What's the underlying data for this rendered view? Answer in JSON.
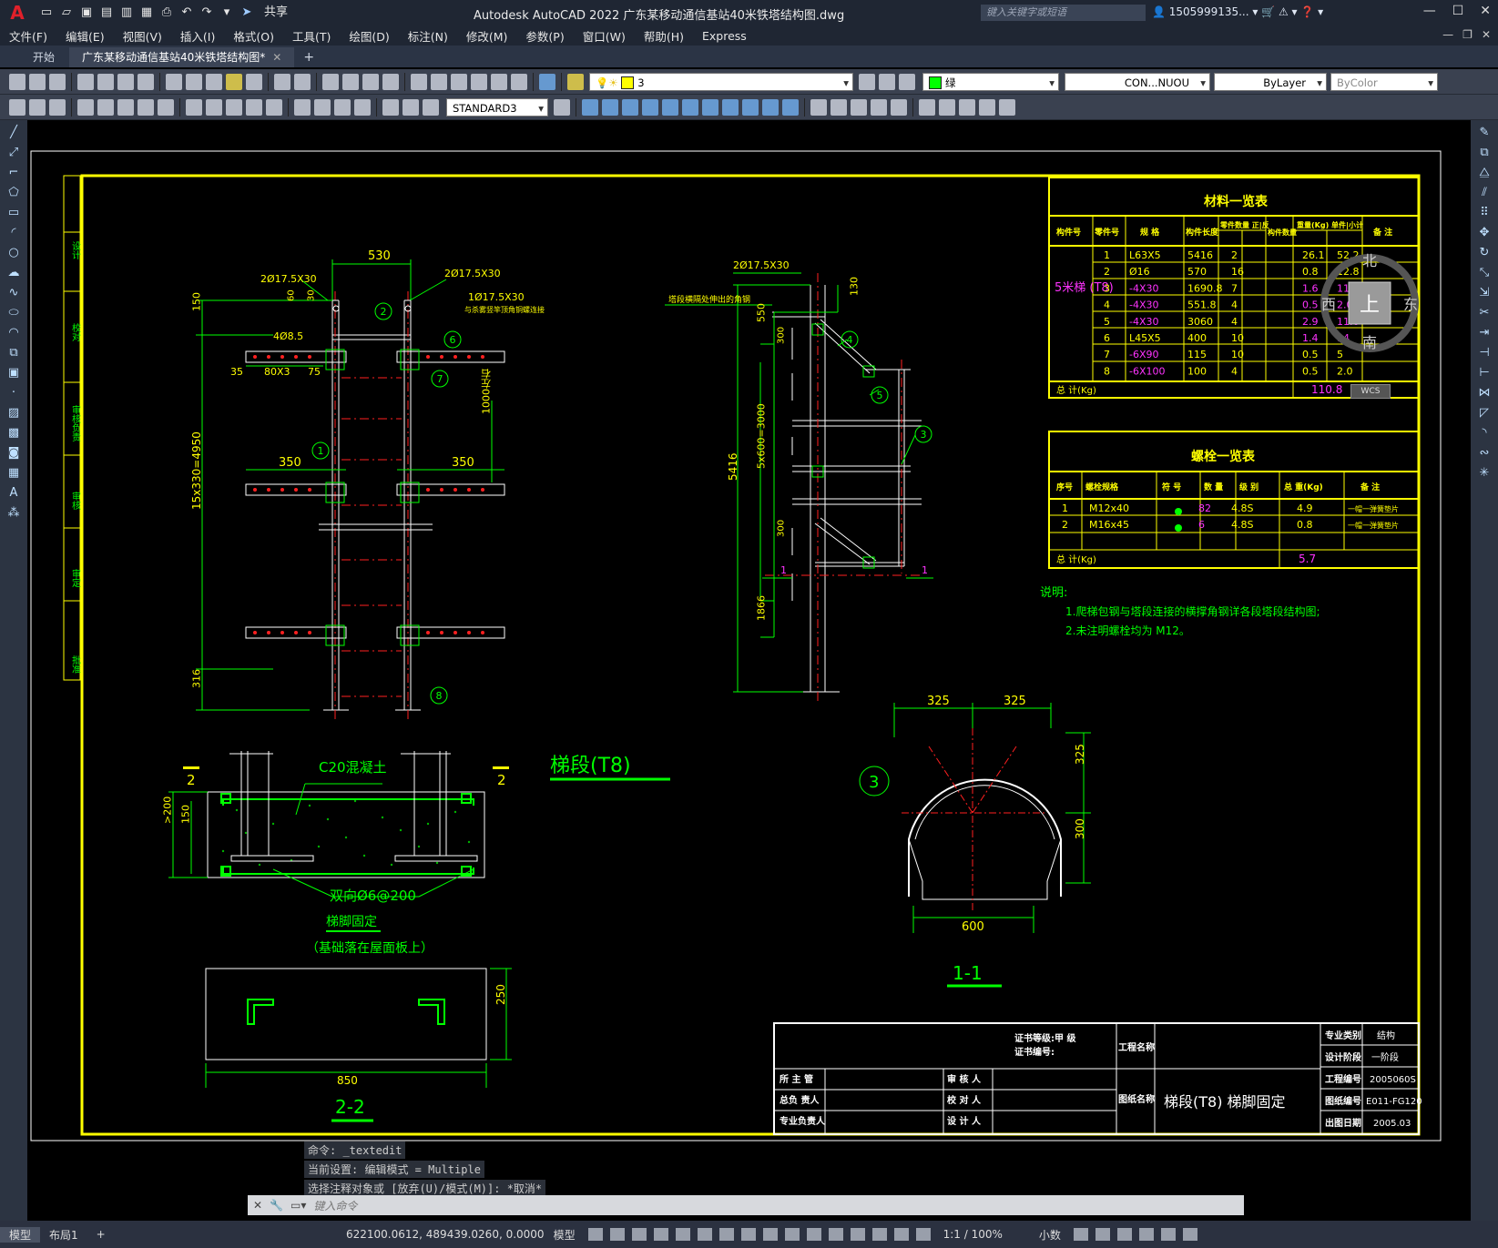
{
  "app": {
    "logo": "A",
    "title": "Autodesk AutoCAD 2022    广东某移动通信基站40米铁塔结构图.dwg",
    "share": "共享",
    "search_placeholder": "键入关键字或短语",
    "user": "1505999135...",
    "window_buttons": [
      "—",
      "☐",
      "✕"
    ]
  },
  "menu": [
    "文件(F)",
    "编辑(E)",
    "视图(V)",
    "插入(I)",
    "格式(O)",
    "工具(T)",
    "绘图(D)",
    "标注(N)",
    "修改(M)",
    "参数(P)",
    "窗口(W)",
    "帮助(H)",
    "Express"
  ],
  "tabs": {
    "start": "开始",
    "drawing": "广东某移动通信基站40米铁塔结构图*",
    "plus": "+"
  },
  "toolbar": {
    "layer_value": "3",
    "color_value": "绿",
    "linetype_value": "CON...NUOU",
    "lineweight_value": "ByLayer",
    "plotstyle_value": "ByColor",
    "dimstyle_value": "STANDARD3"
  },
  "viewcube": {
    "north": "北",
    "south": "南",
    "east": "东",
    "west": "西",
    "face": "上",
    "wcs": "WCS"
  },
  "drawing": {
    "dims_left": [
      "530",
      "2Ø17.5X30",
      "2Ø17.5X30",
      "1Ø17.5X30",
      "与杀雾竖竿顶角铜螺连接",
      "4Ø8.5",
      "80X3",
      "35",
      "75",
      "150",
      "60",
      "30",
      "350",
      "350",
      "1000左右",
      "15x330=4950",
      "316"
    ],
    "balloons_left": [
      "1",
      "2",
      "6",
      "7",
      "8"
    ],
    "dims_mid": [
      "2Ø17.5X30",
      "塔段横隔处伸出的角钢",
      "130",
      "550",
      "300",
      "5416",
      "5x600=3000",
      "300",
      "1866",
      "1",
      "1"
    ],
    "balloons_mid": [
      "4",
      "5",
      "3"
    ],
    "ladder_title": "梯段(T8)",
    "section_22": {
      "label_c20": "C20混凝土",
      "rebar": "双向Ø6@200",
      "d200": ">200",
      "d150": "150",
      "mark": "2",
      "title": "梯脚固定",
      "subtitle": "（基础落在屋面板上）",
      "w": "850",
      "h": "250",
      "view": "2-2"
    },
    "section_11": {
      "d1": "325",
      "d2": "325",
      "d3": "325",
      "d4": "300",
      "w": "600",
      "balloon": "3",
      "view": "1-1"
    },
    "side_labels": [
      "设计",
      "校对",
      "审核负责",
      "审核",
      "审定",
      "批准"
    ]
  },
  "materials": {
    "title": "材料一览表",
    "headers": [
      "构件号",
      "零件号",
      "规  格",
      "构件长度",
      "零件数量 正|反",
      "构件数量",
      "重量(Kg) 单件|小计",
      "备  注"
    ],
    "group_label": "5米梯 (T8)",
    "rows": [
      [
        "1",
        "L63X5",
        "5416",
        "2",
        "26.1",
        "52.2"
      ],
      [
        "2",
        "Ø16",
        "570",
        "16",
        "0.8",
        "12.8"
      ],
      [
        "3",
        "-4X30",
        "1690.8",
        "7",
        "1.6",
        "11.2"
      ],
      [
        "4",
        "-4X30",
        "551.8",
        "4",
        "0.5",
        "2.0"
      ],
      [
        "5",
        "-4X30",
        "3060",
        "4",
        "2.9",
        "11.6"
      ],
      [
        "6",
        "L45X5",
        "400",
        "10",
        "1.4",
        "14"
      ],
      [
        "7",
        "-6X90",
        "115",
        "10",
        "0.5",
        "5"
      ],
      [
        "8",
        "-6X100",
        "100",
        "4",
        "0.5",
        "2.0"
      ]
    ],
    "total_label": "总      计(Kg)",
    "total": "110.8"
  },
  "bolts": {
    "title": "螺栓一览表",
    "headers": [
      "序号",
      "螺栓规格",
      "符  号",
      "数  量",
      "级  别",
      "总  重(Kg)",
      "备  注"
    ],
    "rows": [
      [
        "1",
        "M12x40",
        "82",
        "4.8S",
        "4.9",
        "一帽一弹簧垫片"
      ],
      [
        "2",
        "M16x45",
        "6",
        "4.8S",
        "0.8",
        "一帽一弹簧垫片"
      ]
    ],
    "total_label": "总      计(Kg)",
    "total": "5.7"
  },
  "notes": {
    "title": "说明:",
    "lines": [
      "1.爬梯包钢与塔段连接的横撑角钢详各段塔段结构图;",
      "2.未注明螺栓均为 M12。"
    ]
  },
  "titleblock": {
    "cert": "证书等级:甲        级",
    "cert_no": "证书编号:",
    "project_name_label": "工程名称",
    "drawing_name_label": "图纸名称",
    "drawing_name": "梯段(T8)  梯脚固定",
    "roles": [
      "所 主 管",
      "总负 责人",
      "专业负责人"
    ],
    "roles2": [
      "审 核 人",
      "校 对 人",
      "设 计 人"
    ],
    "right": [
      [
        "专业类别",
        "结构"
      ],
      [
        "设计阶段",
        "一阶段"
      ],
      [
        "工程编号",
        "2005060S"
      ],
      [
        "图纸编号",
        "E011-FG120"
      ],
      [
        "出图日期",
        "2005.03"
      ]
    ]
  },
  "command": {
    "history": [
      "命令: _textedit",
      "当前设置: 编辑模式 = Multiple",
      "选择注释对象或 [放弃(U)/模式(M)]: *取消*"
    ],
    "placeholder": "键入命令"
  },
  "layouts": [
    "模型",
    "布局1",
    "+"
  ],
  "status": {
    "coords": "622100.0612, 489439.0260, 0.0000",
    "model": "模型",
    "scale": "1:1 / 100%",
    "units": "小数"
  },
  "colors": {
    "yellow": "#ffff00",
    "green": "#00ff00",
    "white": "#ffffff",
    "red": "#ff2020",
    "magenta": "#ff33ff",
    "cyan": "#00ffff"
  }
}
